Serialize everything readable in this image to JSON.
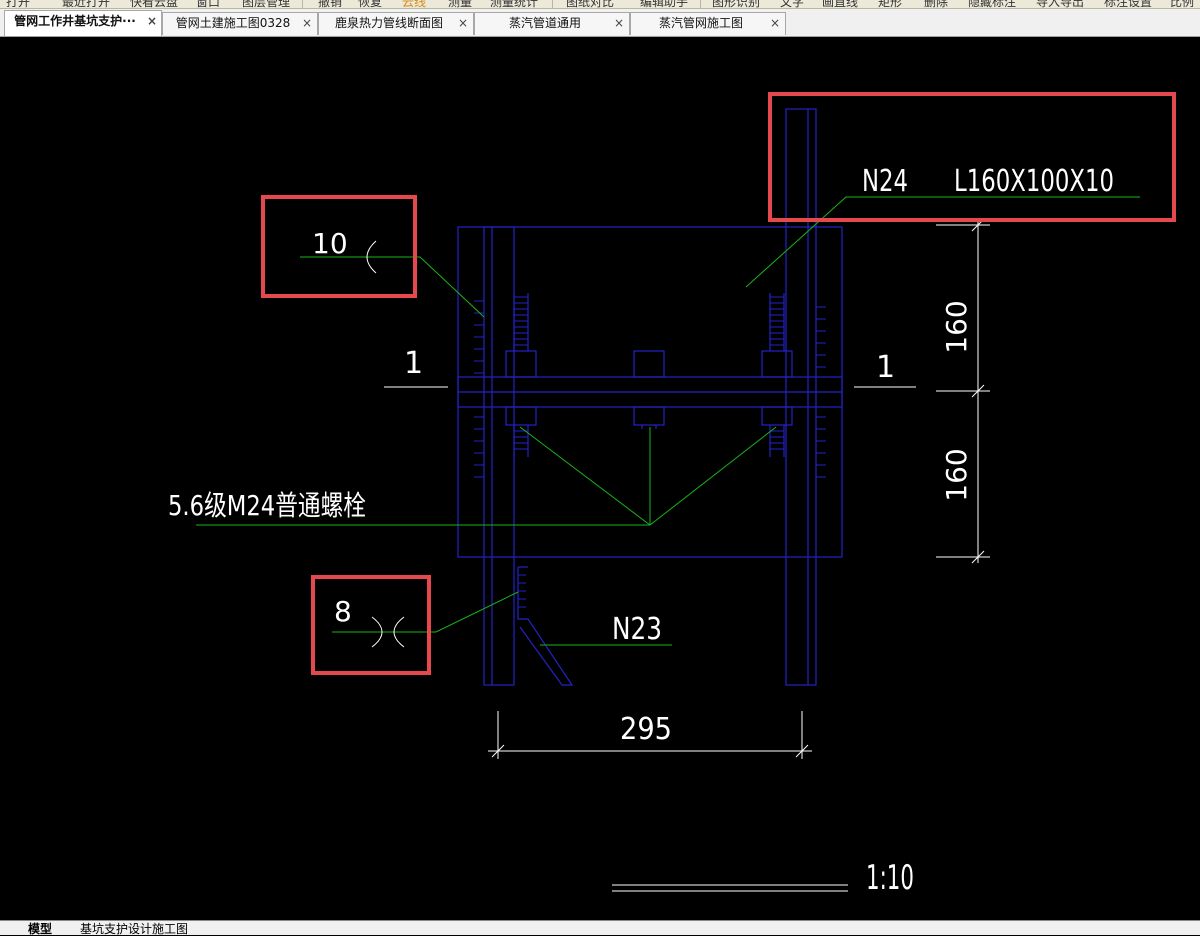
{
  "toolbar": {
    "items": [
      "打开",
      "最近打开",
      "快看云盘",
      "窗口",
      "图层管理",
      "撤销",
      "恢复",
      "云线",
      "测量",
      "测量统计",
      "图纸对比",
      "编辑助手",
      "图形识别",
      "文字",
      "画直线",
      "矩形",
      "删除",
      "隐藏标注",
      "导入导出",
      "标注设置",
      "比例"
    ]
  },
  "tabs": [
    {
      "label": "管网工作井基坑支护···",
      "active": true
    },
    {
      "label": "管网土建施工图0328",
      "active": false
    },
    {
      "label": "鹿泉热力管线断面图",
      "active": false
    },
    {
      "label": "蒸汽管道通用",
      "active": false
    },
    {
      "label": "蒸汽管网施工图",
      "active": false
    }
  ],
  "tab_close_glyph": "×",
  "drawing": {
    "annotation_n24": "N24",
    "annotation_angle": "L160X100X10",
    "weld_top_size": "10",
    "weld_bottom_size": "8",
    "section_mark_left": "1",
    "section_mark_right": "1",
    "dim_vertical_top": "160",
    "dim_vertical_bottom": "160",
    "dim_horizontal": "295",
    "bolt_label": "5.6级M24普通螺栓",
    "annotation_n23": "N23",
    "scale": "1:10"
  },
  "layout_tabs": [
    "模型",
    "基坑支护设计施工图"
  ],
  "colors": {
    "steel": "#2323c8",
    "leader": "#18b418",
    "text": "#ffffff",
    "highlight": "#e5484d",
    "canvas": "#000000"
  }
}
